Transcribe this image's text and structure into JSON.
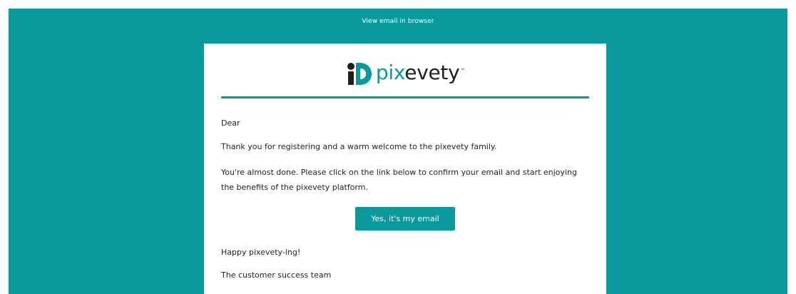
{
  "header": {
    "view_in_browser": "View email in browser"
  },
  "brand": {
    "logo_prefix": "pix",
    "logo_suffix": "evety",
    "logo_trademark": "™",
    "logo_icon": "id-mark-icon"
  },
  "email": {
    "greeting": "Dear",
    "intro": "Thank you for registering and a warm welcome to the pixevety family.",
    "instructions": "You're almost done. Please click on the link below to confirm your email and start enjoying the benefits of the pixevety platform.",
    "confirm_button": "Yes, it's my email",
    "signoff": "Happy pixevety-ing!",
    "signature": "The customer success team"
  },
  "colors": {
    "brand_teal": "#0a9a9c",
    "text": "#1f1f1f",
    "card": "#ffffff"
  }
}
